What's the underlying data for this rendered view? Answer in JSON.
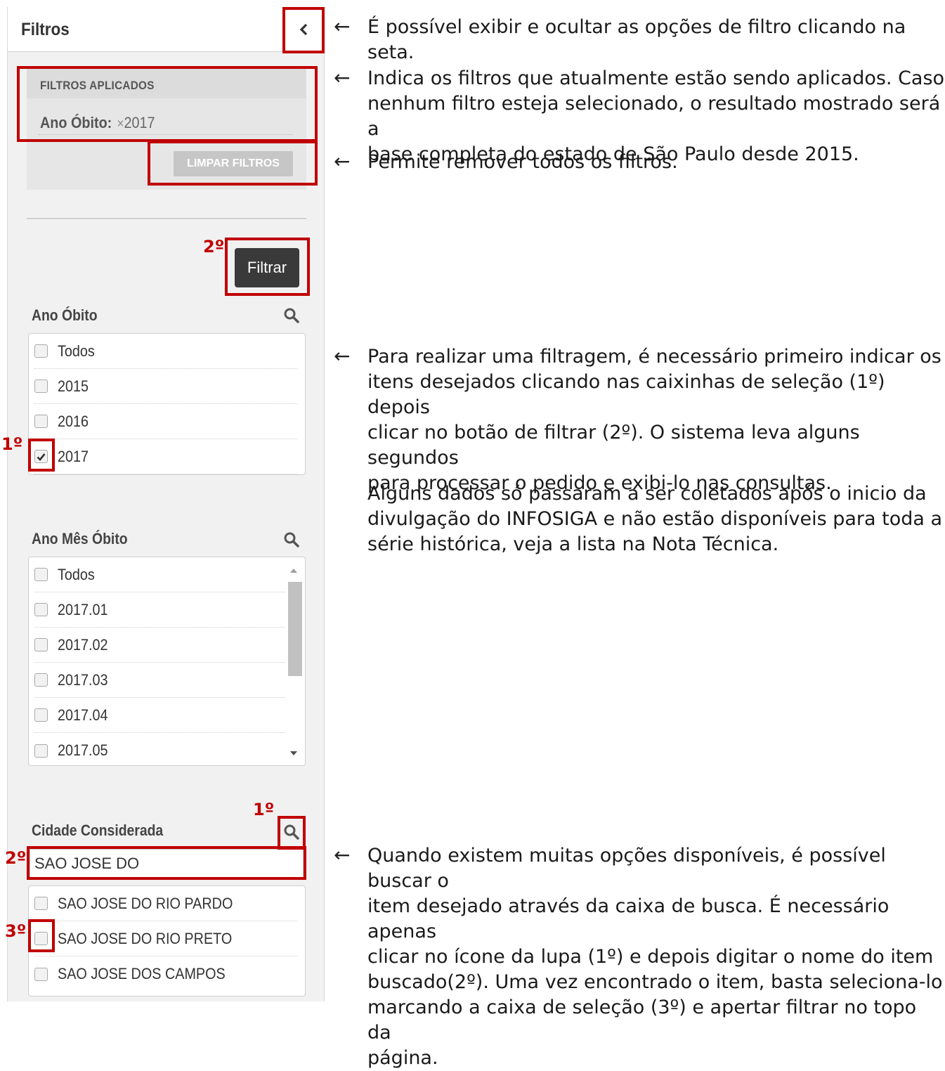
{
  "sidebar": {
    "title": "Filtros",
    "collapse_icon": "chevron-left-icon",
    "applied": {
      "title": "FILTROS APLICADOS",
      "filter_label": "Ano Óbito:",
      "filter_remove": "×",
      "filter_value": "2017",
      "clear_label": "LIMPAR FILTROS"
    },
    "filter_button": "Filtrar",
    "sections": {
      "ano_obito": {
        "title": "Ano Óbito",
        "items": [
          {
            "label": "Todos",
            "checked": false
          },
          {
            "label": "2015",
            "checked": false
          },
          {
            "label": "2016",
            "checked": false
          },
          {
            "label": "2017",
            "checked": true
          }
        ]
      },
      "ano_mes_obito": {
        "title": "Ano Mês Óbito",
        "items": [
          {
            "label": "Todos",
            "checked": false
          },
          {
            "label": "2017.01",
            "checked": false
          },
          {
            "label": "2017.02",
            "checked": false
          },
          {
            "label": "2017.03",
            "checked": false
          },
          {
            "label": "2017.04",
            "checked": false
          },
          {
            "label": "2017.05",
            "checked": false
          }
        ]
      },
      "cidade": {
        "title": "Cidade Considerada",
        "search_value": "SAO JOSE DO",
        "items": [
          {
            "label": "SAO JOSE DO RIO PARDO",
            "checked": false
          },
          {
            "label": "SAO JOSE DO RIO PRETO",
            "checked": false
          },
          {
            "label": "SAO JOSE DOS CAMPOS",
            "checked": false
          }
        ]
      }
    }
  },
  "steps": {
    "filtrar": "2º",
    "checkbox": "1º",
    "lupa": "1º",
    "busca": "2º",
    "selecao": "3º"
  },
  "annotations": {
    "arrow": "←",
    "toggle": [
      "É possível exibir e ocultar as opções de filtro clicando na seta."
    ],
    "applied": [
      "Indica os filtros que atualmente estão sendo aplicados. Caso",
      "nenhum filtro esteja selecionado, o resultado mostrado será a",
      "base completa do estado de São Paulo desde 2015."
    ],
    "clear": [
      "Permite remover todos os filtros."
    ],
    "filtering": [
      "Para realizar uma filtragem, é necessário primeiro indicar os",
      "itens desejados clicando nas caixinhas de seleção (1º) depois",
      "clicar no botão de filtrar (2º). O sistema leva alguns segundos",
      "para processar o pedido e exibi-lo nas consultas."
    ],
    "data_note": [
      "Alguns dados só passaram a ser coletados após o inicio da",
      "divulgação do INFOSIGA e não estão disponíveis para toda a",
      "série histórica, veja a lista na Nota Técnica."
    ],
    "search": [
      "Quando existem muitas opções disponíveis, é possível buscar o",
      "item desejado através da caixa de busca. É necessário apenas",
      "clicar no ícone da lupa (1º) e depois digitar o nome do item",
      "buscado(2º). Uma vez encontrado o item, basta seleciona-lo",
      "marcando a caixa de seleção (3º) e apertar filtrar no topo da",
      "página."
    ]
  }
}
